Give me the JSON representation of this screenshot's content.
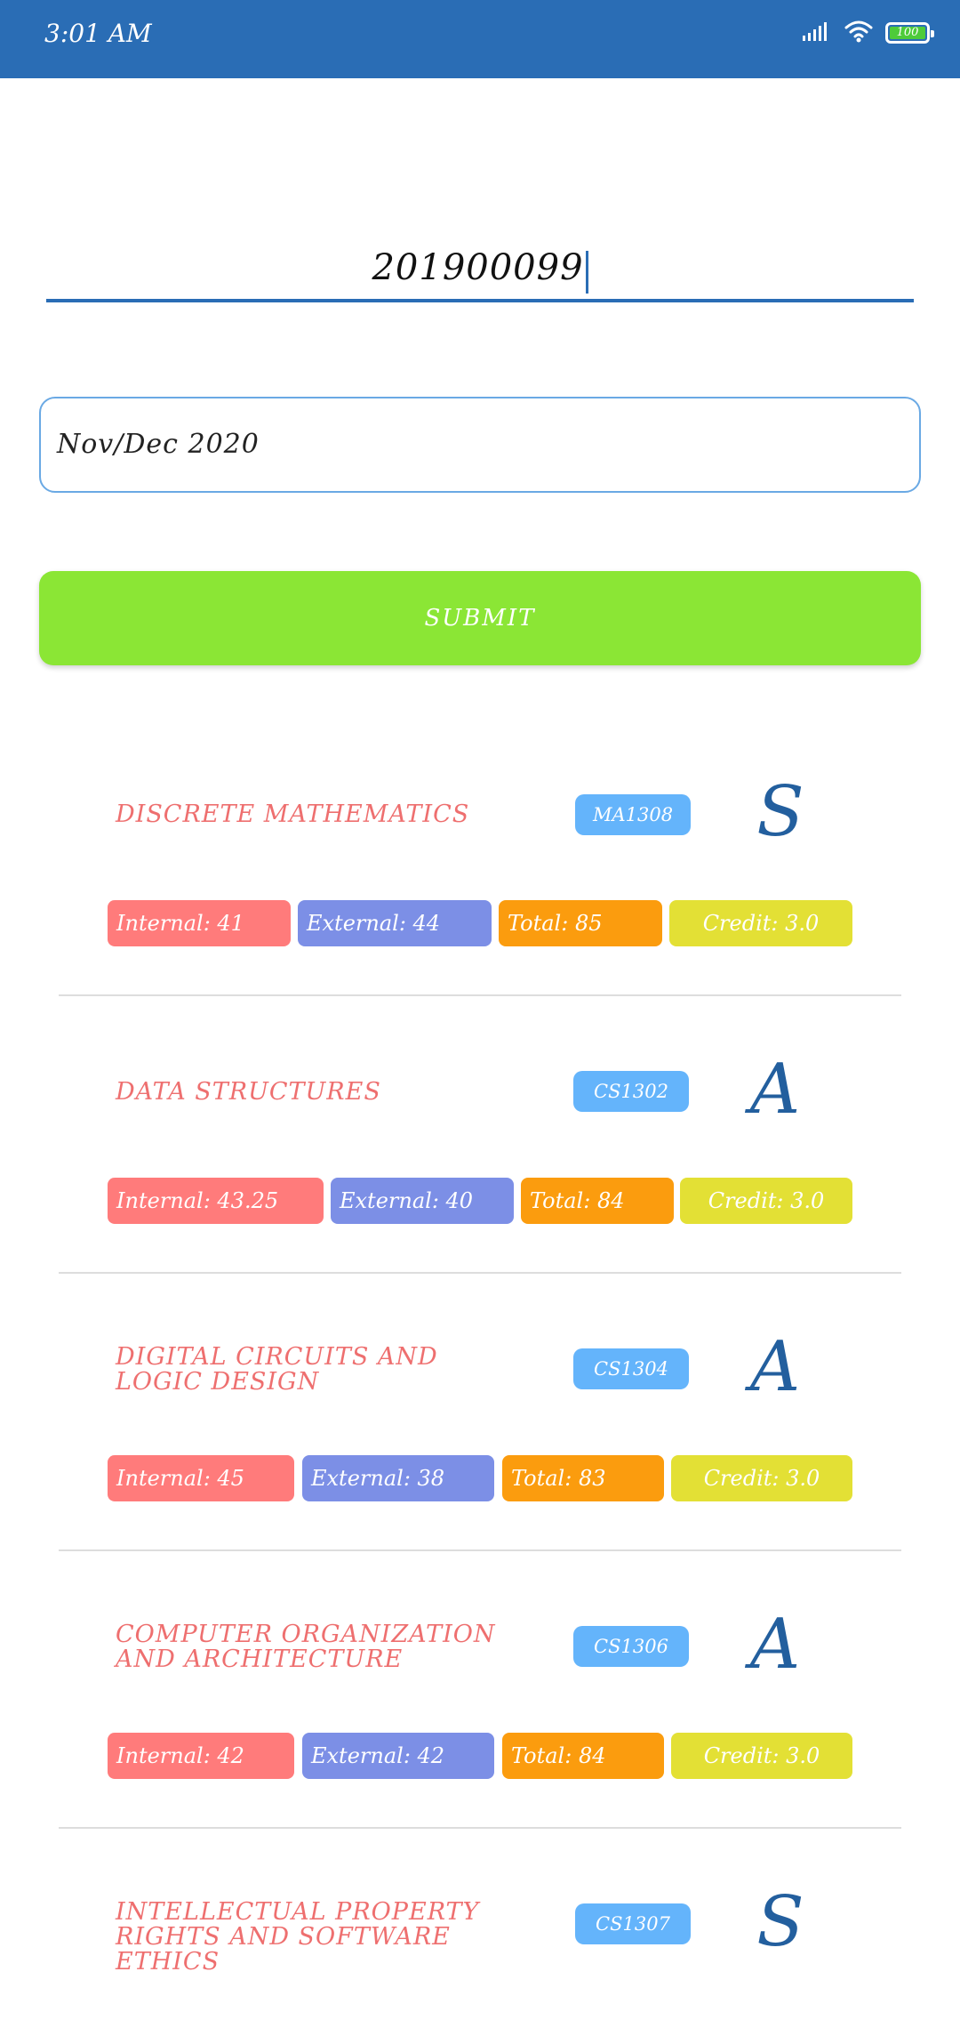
{
  "status_bar": {
    "time": "3:01 AM",
    "battery": "100",
    "battery_level": 1.0
  },
  "form": {
    "reg_number": "201900099",
    "exam_session": "Nov/Dec 2020",
    "submit_label": "SUBMIT"
  },
  "labels": {
    "internal": "Internal:",
    "external": "External:",
    "total": "Total:",
    "credit": "Credit:"
  },
  "courses": [
    {
      "name": "DISCRETE MATHEMATICS",
      "code": "MA1308",
      "grade": "S",
      "internal": "Internal: 41",
      "external": "External: 44",
      "total": "Total: 85",
      "credit": "Credit: 3.0"
    },
    {
      "name": "DATA STRUCTURES",
      "code": "CS1302",
      "grade": "A",
      "internal": "Internal: 43.25",
      "external": "External: 40",
      "total": "Total: 84",
      "credit": "Credit: 3.0"
    },
    {
      "name": "DIGITAL CIRCUITS AND LOGIC DESIGN",
      "code": "CS1304",
      "grade": "A",
      "internal": "Internal: 45",
      "external": "External: 38",
      "total": "Total: 83",
      "credit": "Credit: 3.0"
    },
    {
      "name": "COMPUTER ORGANIZATION AND ARCHITECTURE",
      "code": "CS1306",
      "grade": "A",
      "internal": "Internal: 42",
      "external": "External: 42",
      "total": "Total: 84",
      "credit": "Credit: 3.0"
    },
    {
      "name": "INTELLECTUAL PROPERTY RIGHTS AND SOFTWARE ETHICS",
      "code": "CS1307",
      "grade": "S"
    }
  ],
  "colors": {
    "header": "#2a6db5",
    "submit": "#8be635",
    "course_name": "#ee6f6f",
    "code_badge": "#64b4fb",
    "grade": "#235f9e",
    "internal_chip": "#ff7b7b",
    "external_chip": "#7c8fe6",
    "total_chip": "#fb9c0e",
    "credit_chip": "#e3e035"
  },
  "icons": [
    "signal-icon",
    "wifi-icon",
    "battery-icon"
  ]
}
